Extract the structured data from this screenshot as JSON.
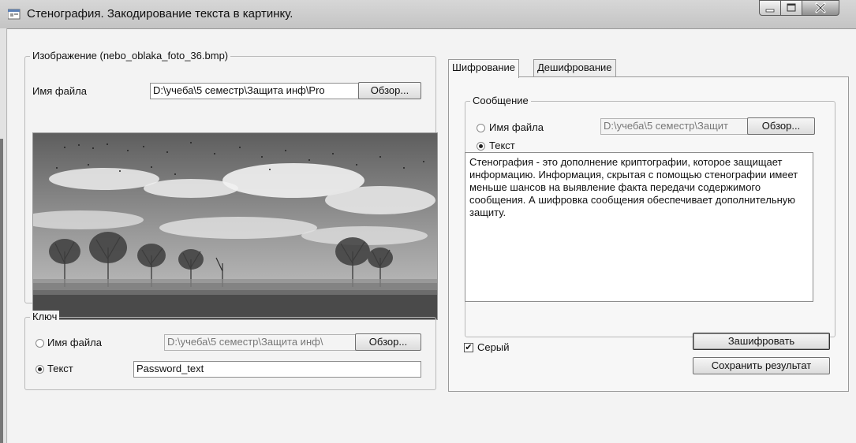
{
  "window": {
    "title": "Стенография. Закодирование текста в картинку."
  },
  "image_group": {
    "legend": "Изображение (nebo_oblaka_foto_36.bmp)",
    "file_label": "Имя файла",
    "file_value": "D:\\учеба\\5 семестр\\Защита инф\\Рrо",
    "browse_label": "Обзор..."
  },
  "key_group": {
    "legend": "Ключ",
    "file_option_label": "Имя файла",
    "file_value": "D:\\учеба\\5 семестр\\Защита инф\\",
    "browse_label": "Обзор...",
    "text_option_label": "Текст",
    "text_value": "Password_text",
    "selected_option": "text"
  },
  "tabs": [
    {
      "label": "Шифрование",
      "active": true
    },
    {
      "label": "Дешифрование",
      "active": false
    }
  ],
  "message_group": {
    "legend": "Сообщение",
    "file_option_label": "Имя файла",
    "file_value": "D:\\учеба\\5 семестр\\Защит",
    "browse_label": "Обзор...",
    "text_option_label": "Текст",
    "selected_option": "text",
    "message_text": "Стенография - это дополнение криптографии, которое защищает информацию. Информация, скрытая с помощью стенографии имеет меньше шансов на выявление факта передачи содержимого сообщения. А шифровка сообщения обеспечивает дополнительную защиту."
  },
  "options": {
    "gray_label": "Серый",
    "gray_checked": true
  },
  "actions": {
    "encrypt_label": "Зашифровать",
    "save_label": "Сохранить результат"
  }
}
